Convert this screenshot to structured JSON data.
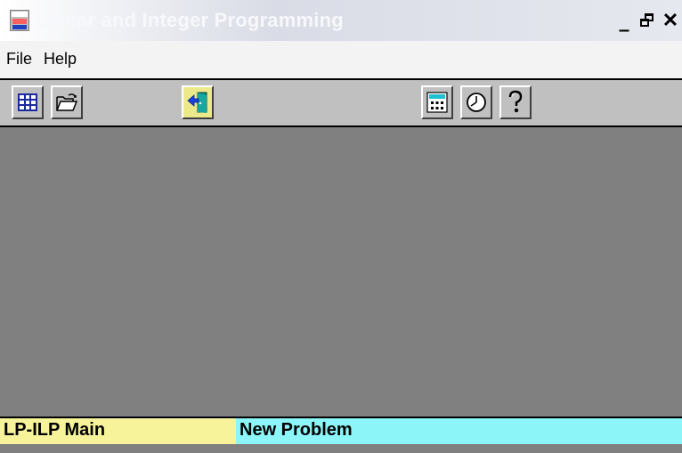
{
  "window": {
    "title": "Linear and Integer Programming",
    "controls": {
      "minimize": "_",
      "close": "✕"
    }
  },
  "menu": [
    {
      "label": "File"
    },
    {
      "label": "Help"
    }
  ],
  "toolbar": {
    "buttons": [
      {
        "icon": "spreadsheet-grid-icon"
      },
      {
        "icon": "open-folder-icon"
      },
      {
        "icon": "exit-door-icon"
      },
      {
        "icon": "calculator-icon"
      },
      {
        "icon": "clock-icon"
      },
      {
        "icon": "help-question-icon"
      }
    ]
  },
  "status": {
    "left": "LP-ILP Main",
    "right": "New Problem"
  },
  "colors": {
    "workspace": "#808080",
    "status_left_bg": "#f7f39a",
    "status_right_bg": "#8bf5f8",
    "toolbar_bg": "#c0c0c0"
  }
}
